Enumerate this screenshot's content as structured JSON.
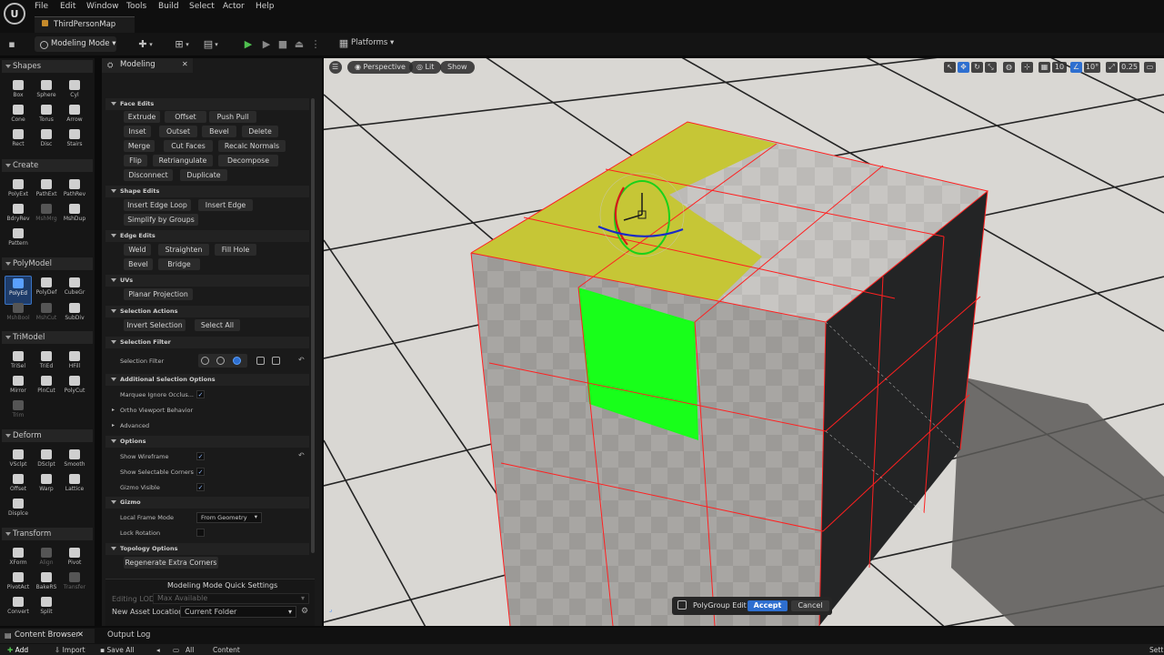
{
  "menu": [
    "File",
    "Edit",
    "Window",
    "Tools",
    "Build",
    "Select",
    "Actor",
    "Help"
  ],
  "map_tab": "ThirdPersonMap",
  "toolbar": {
    "mode": "Modeling Mode",
    "platforms": "Platforms"
  },
  "shapes_panel": {
    "sections": [
      {
        "title": "Shapes",
        "tools": [
          {
            "label": "Box"
          },
          {
            "label": "Sphere"
          },
          {
            "label": "Cyl"
          },
          {
            "label": "Cone"
          },
          {
            "label": "Torus"
          },
          {
            "label": "Arrow"
          },
          {
            "label": "Rect"
          },
          {
            "label": "Disc"
          },
          {
            "label": "Stairs"
          }
        ]
      },
      {
        "title": "Create",
        "tools": [
          {
            "label": "PolyExt"
          },
          {
            "label": "PathExt"
          },
          {
            "label": "PathRev"
          },
          {
            "label": "BdryRev"
          },
          {
            "label": "MshMrg",
            "dim": true
          },
          {
            "label": "MshDup"
          },
          {
            "label": "Pattern"
          }
        ]
      },
      {
        "title": "PolyModel",
        "tools": [
          {
            "label": "PolyEd",
            "active": true
          },
          {
            "label": "PolyDef"
          },
          {
            "label": "CubeGr"
          },
          {
            "label": "MshBool",
            "dim": true
          },
          {
            "label": "MshCut",
            "dim": true
          },
          {
            "label": "SubDiv"
          }
        ]
      },
      {
        "title": "TriModel",
        "tools": [
          {
            "label": "TriSel"
          },
          {
            "label": "TriEd"
          },
          {
            "label": "HFill"
          },
          {
            "label": "Mirror"
          },
          {
            "label": "PlnCut"
          },
          {
            "label": "PolyCut"
          },
          {
            "label": "Trim",
            "dim": true
          }
        ]
      },
      {
        "title": "Deform",
        "tools": [
          {
            "label": "VSclpt"
          },
          {
            "label": "DSclpt"
          },
          {
            "label": "Smooth"
          },
          {
            "label": "Offset"
          },
          {
            "label": "Warp"
          },
          {
            "label": "Lattice"
          },
          {
            "label": "Displce"
          }
        ]
      },
      {
        "title": "Transform",
        "tools": [
          {
            "label": "XForm"
          },
          {
            "label": "Align",
            "dim": true
          },
          {
            "label": "Pivot"
          },
          {
            "label": "PivotAct"
          },
          {
            "label": "BakeRS"
          },
          {
            "label": "Transfer",
            "dim": true
          },
          {
            "label": "Convert"
          },
          {
            "label": "Split"
          }
        ]
      }
    ]
  },
  "modeling_panel": {
    "tab": "Modeling",
    "face_edits": {
      "title": "Face Edits",
      "buttons": [
        "Extrude",
        "Offset",
        "Push Pull",
        "Inset",
        "Outset",
        "Bevel",
        "Delete",
        "Merge",
        "Cut Faces",
        "Recalc Normals",
        "Flip",
        "Retriangulate",
        "Decompose",
        "Disconnect",
        "Duplicate"
      ]
    },
    "shape_edits": {
      "title": "Shape Edits",
      "buttons": [
        "Insert Edge Loop",
        "Insert Edge",
        "Simplify by Groups"
      ]
    },
    "edge_edits": {
      "title": "Edge Edits",
      "buttons": [
        "Weld",
        "Straighten",
        "Fill Hole",
        "Bevel",
        "Bridge"
      ]
    },
    "uvs": {
      "title": "UVs",
      "buttons": [
        "Planar Projection"
      ]
    },
    "selection_actions": {
      "title": "Selection Actions",
      "buttons": [
        "Invert Selection",
        "Select All"
      ]
    },
    "selection_filter": {
      "title": "Selection Filter",
      "label": "Selection Filter"
    },
    "additional": {
      "title": "Additional Selection Options",
      "marquee": "Marquee Ignore Occlus...",
      "ortho": "Ortho Viewport Behavior",
      "advanced": "Advanced"
    },
    "options": {
      "title": "Options",
      "wireframe": "Show Wireframe",
      "corners": "Show Selectable Corners",
      "gizmo_visible": "Gizmo Visible"
    },
    "gizmo": {
      "title": "Gizmo",
      "local_frame": "Local Frame Mode",
      "local_frame_value": "From Geometry",
      "lock_rotation": "Lock Rotation"
    },
    "topology": {
      "title": "Topology Options",
      "button": "Regenerate Extra Corners"
    },
    "quick_settings": {
      "title": "Modeling Mode Quick Settings",
      "editing_lod": "Editing LOD",
      "editing_lod_value": "Max Available",
      "asset_location": "New Asset Location",
      "asset_location_value": "Current Folder"
    }
  },
  "viewport": {
    "perspective": "Perspective",
    "lit": "Lit",
    "show": "Show",
    "grid_snap": "10",
    "angle_snap": "10°",
    "scale_snap": "0.25",
    "polybar": {
      "label": "PolyGroup Edit",
      "accept": "Accept",
      "cancel": "Cancel"
    }
  },
  "bottom": {
    "content_browser": "Content Browser",
    "output_log": "Output Log",
    "add": "Add",
    "import": "Import",
    "save_all": "Save All",
    "crumb_all": "All",
    "crumb_content": "Content",
    "settings": "Sett"
  },
  "colors": {
    "accent": "#2e6fd0",
    "selected_face": "#18ff1a",
    "highlight_face": "#c6c636",
    "wire": "#ff2020"
  }
}
